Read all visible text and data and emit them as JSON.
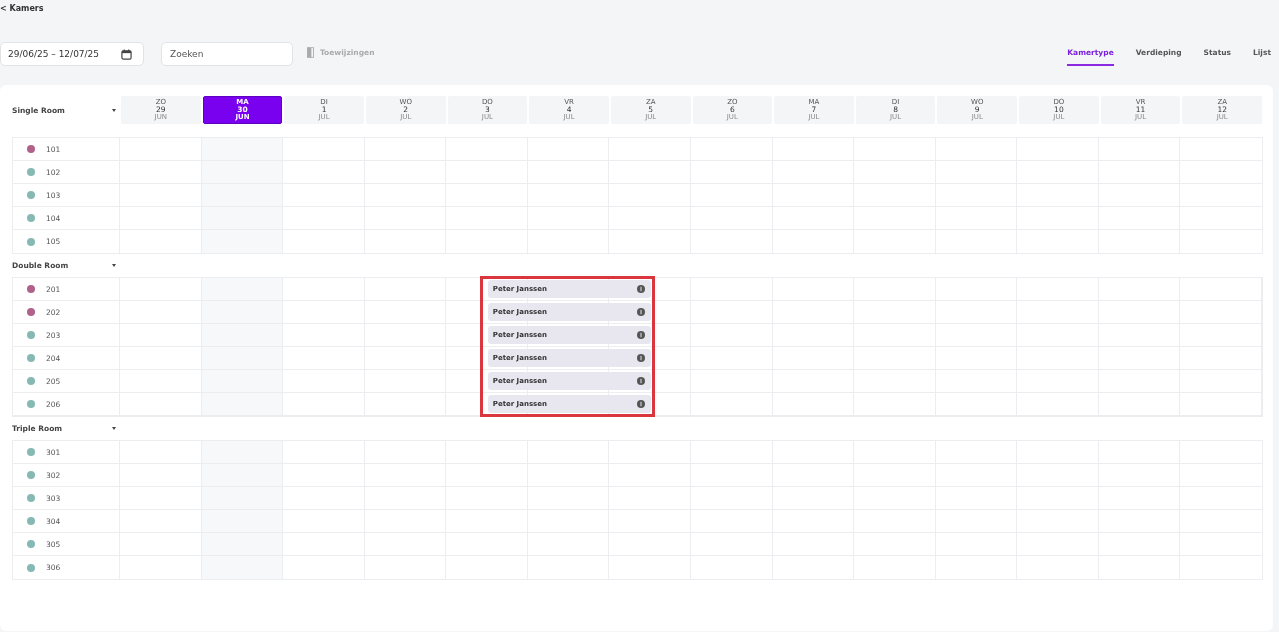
{
  "back_link": "< Kamers",
  "toolbar": {
    "date_range": "29/06/25 – 12/07/25",
    "search": {
      "placeholder": "Zoeken"
    },
    "assignments": {
      "label": "Toewijzingen",
      "disabled": true
    }
  },
  "view_tabs": [
    {
      "label": "Kamertype",
      "selected": true
    },
    {
      "label": "Verdieping",
      "selected": false
    },
    {
      "label": "Status",
      "selected": false
    },
    {
      "label": "Lijst",
      "selected": false
    }
  ],
  "days": [
    {
      "weekday": "ZO",
      "day": "29",
      "month": "JUN",
      "selected": false
    },
    {
      "weekday": "MA",
      "day": "30",
      "month": "JUN",
      "selected": true
    },
    {
      "weekday": "DI",
      "day": "1",
      "month": "JUL",
      "selected": false
    },
    {
      "weekday": "WO",
      "day": "2",
      "month": "JUL",
      "selected": false
    },
    {
      "weekday": "DO",
      "day": "3",
      "month": "JUL",
      "selected": false
    },
    {
      "weekday": "VR",
      "day": "4",
      "month": "JUL",
      "selected": false
    },
    {
      "weekday": "ZA",
      "day": "5",
      "month": "JUL",
      "selected": false
    },
    {
      "weekday": "ZO",
      "day": "6",
      "month": "JUL",
      "selected": false
    },
    {
      "weekday": "MA",
      "day": "7",
      "month": "JUL",
      "selected": false
    },
    {
      "weekday": "DI",
      "day": "8",
      "month": "JUL",
      "selected": false
    },
    {
      "weekday": "WO",
      "day": "9",
      "month": "JUL",
      "selected": false
    },
    {
      "weekday": "DO",
      "day": "10",
      "month": "JUL",
      "selected": false
    },
    {
      "weekday": "VR",
      "day": "11",
      "month": "JUL",
      "selected": false
    },
    {
      "weekday": "ZA",
      "day": "12",
      "month": "JUL",
      "selected": false
    }
  ],
  "room_groups": [
    {
      "name": "Single Room",
      "expanded": true,
      "rooms": [
        {
          "number": "101",
          "color": "#b0628a"
        },
        {
          "number": "102",
          "color": "#86b9b3"
        },
        {
          "number": "103",
          "color": "#86b9b3"
        },
        {
          "number": "104",
          "color": "#86b9b3"
        },
        {
          "number": "105",
          "color": "#86b9b3"
        }
      ]
    },
    {
      "name": "Double Room",
      "expanded": true,
      "highlighted": true,
      "rooms": [
        {
          "number": "201",
          "color": "#b0628a",
          "booking": {
            "guest": "Peter Janssen"
          }
        },
        {
          "number": "202",
          "color": "#b0628a",
          "booking": {
            "guest": "Peter Janssen"
          }
        },
        {
          "number": "203",
          "color": "#86b9b3",
          "booking": {
            "guest": "Peter Janssen"
          }
        },
        {
          "number": "204",
          "color": "#86b9b3",
          "booking": {
            "guest": "Peter Janssen"
          }
        },
        {
          "number": "205",
          "color": "#86b9b3",
          "booking": {
            "guest": "Peter Janssen"
          }
        },
        {
          "number": "206",
          "color": "#86b9b3",
          "booking": {
            "guest": "Peter Janssen"
          }
        }
      ]
    },
    {
      "name": "Triple Room",
      "expanded": true,
      "rooms": [
        {
          "number": "301",
          "color": "#86b9b3"
        },
        {
          "number": "302",
          "color": "#86b9b3"
        },
        {
          "number": "303",
          "color": "#86b9b3"
        },
        {
          "number": "304",
          "color": "#86b9b3"
        },
        {
          "number": "305",
          "color": "#86b9b3"
        },
        {
          "number": "306",
          "color": "#86b9b3"
        }
      ]
    }
  ]
}
